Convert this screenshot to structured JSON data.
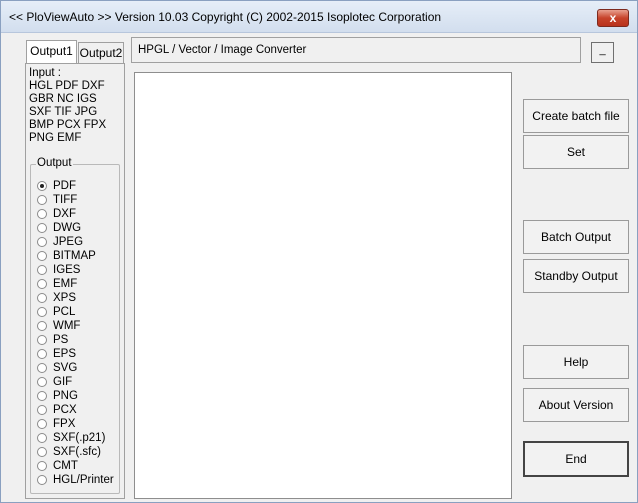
{
  "window": {
    "title": "<< PloViewAuto >>  Version 10.03 Copyright (C) 2002-2015 Isoplotec Corporation",
    "close_glyph": "x"
  },
  "tabs": [
    {
      "label": "Output1",
      "active": true
    },
    {
      "label": "Output2",
      "active": false
    }
  ],
  "input": {
    "lines": [
      "Input :",
      "HGL PDF DXF",
      "GBR NC  IGS",
      "SXF TIF JPG",
      "BMP PCX FPX",
      "PNG EMF"
    ]
  },
  "output": {
    "legend": "Output",
    "selected": "PDF",
    "options": [
      "PDF",
      "TIFF",
      "DXF",
      "DWG",
      "JPEG",
      "BITMAP",
      "IGES",
      "EMF",
      "XPS",
      "PCL",
      "WMF",
      "PS",
      "EPS",
      "SVG",
      "GIF",
      "PNG",
      "PCX",
      "FPX",
      "SXF(.p21)",
      "SXF(.sfc)",
      "CMT",
      "HGL/Printer"
    ]
  },
  "header": {
    "label": "HPGL / Vector / Image Converter",
    "small_button": "_"
  },
  "buttons": {
    "create_batch": "Create batch file",
    "set": "Set",
    "batch_output": "Batch Output",
    "standby_output": "Standby Output",
    "help": "Help",
    "about": "About Version",
    "end": "End"
  }
}
